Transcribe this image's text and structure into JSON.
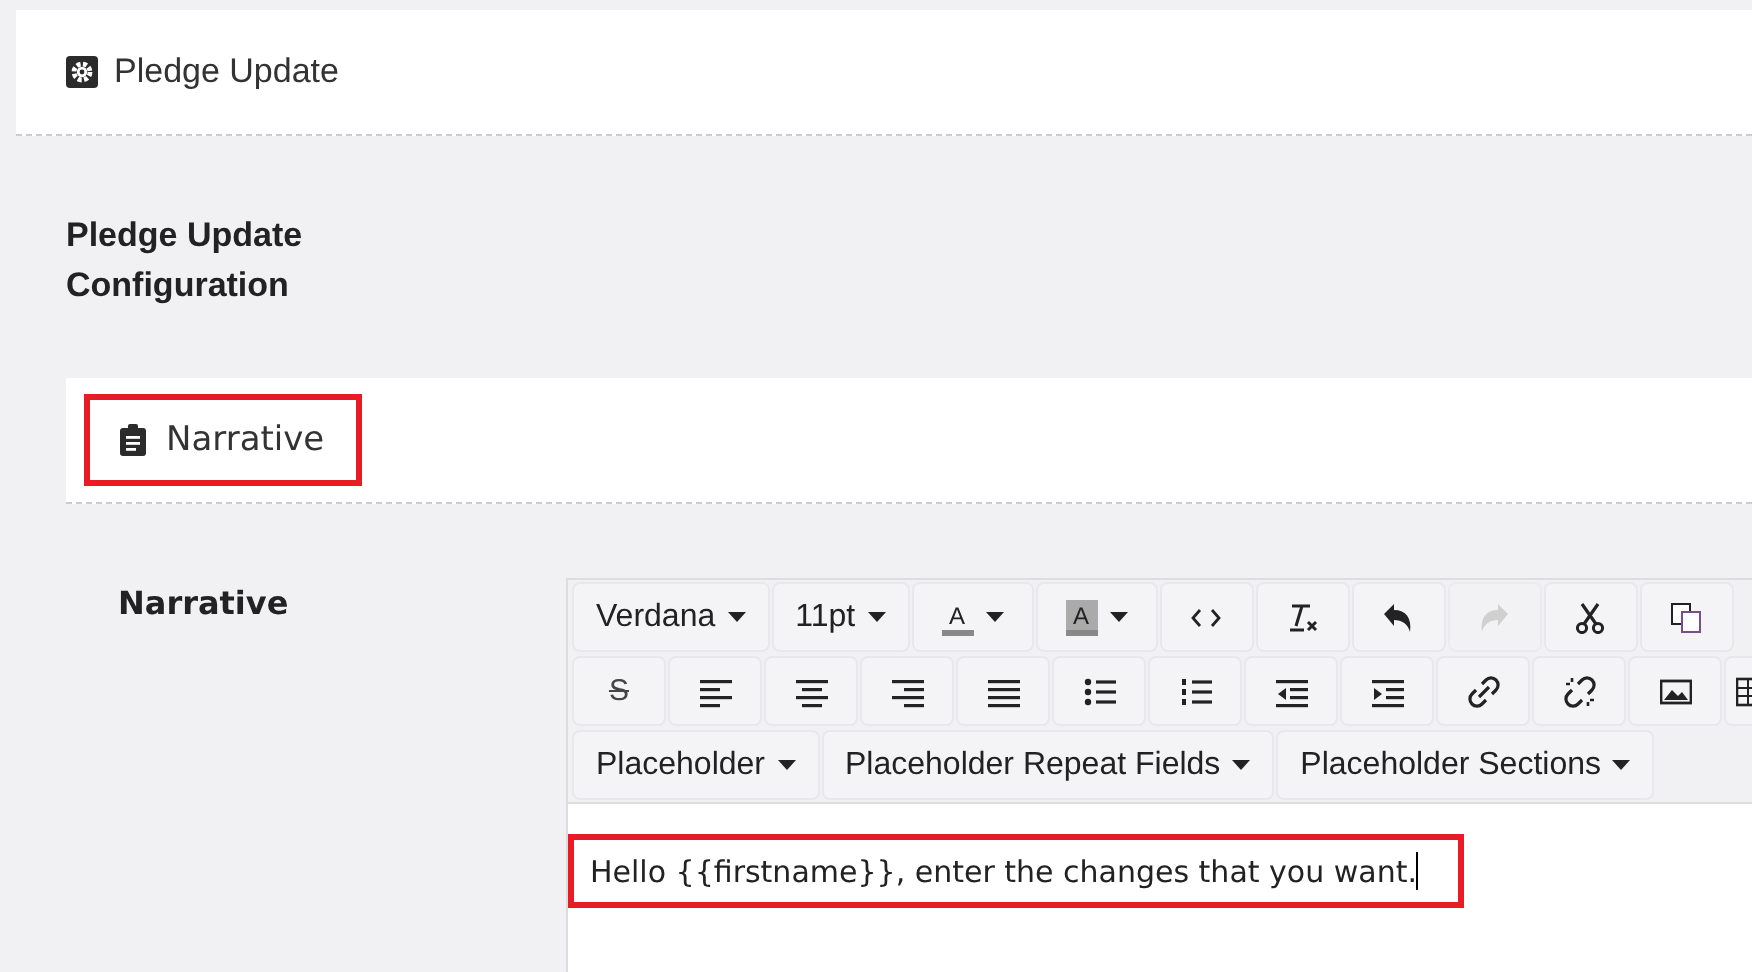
{
  "header": {
    "title": "Pledge Update"
  },
  "section_heading": "Pledge Update Configuration",
  "panel": {
    "title": "Narrative",
    "highlighted": true
  },
  "field": {
    "label": "Narrative",
    "toolbar": [
      [
        {
          "kind": "dropdown",
          "label": "Verdana"
        },
        {
          "kind": "dropdown",
          "label": "11pt"
        },
        {
          "kind": "textcolor",
          "label": "A"
        },
        {
          "kind": "highlight",
          "label": "A"
        },
        {
          "kind": "code",
          "disabled": false
        },
        {
          "kind": "clearformat",
          "disabled": false
        },
        {
          "kind": "undo",
          "disabled": false
        },
        {
          "kind": "redo",
          "disabled": true
        },
        {
          "kind": "cut",
          "disabled": false
        },
        {
          "kind": "copy",
          "disabled": false
        }
      ],
      [
        {
          "kind": "strike",
          "label": "S"
        },
        {
          "kind": "alignleft",
          "disabled": false
        },
        {
          "kind": "aligncenter",
          "disabled": false
        },
        {
          "kind": "alignright",
          "disabled": false
        },
        {
          "kind": "justify",
          "disabled": false
        },
        {
          "kind": "bullets",
          "disabled": false
        },
        {
          "kind": "numbers",
          "disabled": false
        },
        {
          "kind": "outdent",
          "disabled": false
        },
        {
          "kind": "indent",
          "disabled": false
        },
        {
          "kind": "link",
          "disabled": false
        },
        {
          "kind": "unlink",
          "disabled": false
        },
        {
          "kind": "image",
          "disabled": false
        },
        {
          "kind": "table"
        }
      ],
      [
        {
          "kind": "dropdown",
          "label": "Placeholder"
        },
        {
          "kind": "dropdown",
          "label": "Placeholder Repeat Fields"
        },
        {
          "kind": "dropdown",
          "label": "Placeholder Sections"
        }
      ]
    ],
    "content": "Hello {{firstname}}, enter the changes that you want.",
    "highlighted": true
  }
}
